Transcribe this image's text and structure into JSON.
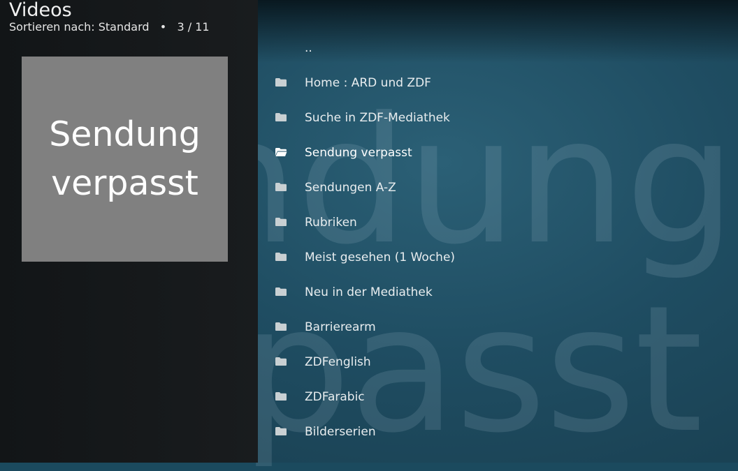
{
  "header": {
    "title": "Videos",
    "sort_label": "Sortieren nach: Standard",
    "separator": "•",
    "position": "3 / 11"
  },
  "preview": {
    "line1": "Sendung",
    "line2": "verpasst"
  },
  "background": {
    "line1": "Sendung",
    "line2": "verpasst"
  },
  "list": {
    "items": [
      {
        "label": "..",
        "icon": "none"
      },
      {
        "label": "Home : ARD und ZDF",
        "icon": "folder-icon"
      },
      {
        "label": "Suche in ZDF-Mediathek",
        "icon": "folder-icon"
      },
      {
        "label": "Sendung verpasst",
        "icon": "folder-icon",
        "selected": true
      },
      {
        "label": "Sendungen A-Z",
        "icon": "folder-icon"
      },
      {
        "label": "Rubriken",
        "icon": "folder-icon"
      },
      {
        "label": "Meist gesehen (1 Woche)",
        "icon": "folder-icon"
      },
      {
        "label": "Neu in der Mediathek",
        "icon": "folder-icon"
      },
      {
        "label": "Barrierearm",
        "icon": "folder-icon"
      },
      {
        "label": "ZDFenglish",
        "icon": "folder-icon"
      },
      {
        "label": "ZDFarabic",
        "icon": "folder-icon"
      },
      {
        "label": "Bilderserien",
        "icon": "folder-icon"
      }
    ]
  },
  "colors": {
    "panel": "#16191b",
    "thumb": "#808080",
    "background": "#1f4d62"
  }
}
